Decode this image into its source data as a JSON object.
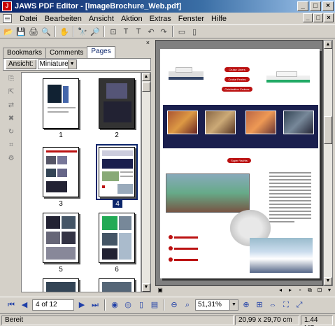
{
  "window": {
    "title": "JAWS PDF Editor - [ImageBrochure_Web.pdf]",
    "app_icon": "J",
    "minimize": "_",
    "maximize": "□",
    "close": "×"
  },
  "menu": {
    "items": [
      "Datei",
      "Bearbeiten",
      "Ansicht",
      "Aktion",
      "Extras",
      "Fenster",
      "Hilfe"
    ],
    "doc_controls": [
      "_",
      "□",
      "×"
    ]
  },
  "toolbar": {
    "icons": [
      "folder-open-icon",
      "save-icon",
      "print-icon",
      "search-doc-icon",
      "hand-icon",
      "binoculars-icon",
      "find-icon",
      "crop-icon",
      "text-tool-icon",
      "text-box-icon",
      "undo-icon",
      "redo-icon",
      "single-page-icon",
      "two-page-icon"
    ],
    "glyphs": [
      "📂",
      "💾",
      "🖨",
      "🔍",
      "✋",
      "🔭",
      "🔎",
      "⊡",
      "T",
      "T",
      "↶",
      "↷",
      "▭",
      "▯"
    ]
  },
  "left_panel": {
    "close_glyph": "×",
    "tabs": [
      "Bookmarks",
      "Comments",
      "Pages"
    ],
    "active_tab": "Pages",
    "view_button": "Ansicht:",
    "view_select": "Miniaturen",
    "pages": [
      {
        "label": "1",
        "selected": false
      },
      {
        "label": "2",
        "selected": false
      },
      {
        "label": "3",
        "selected": false
      },
      {
        "label": "4",
        "selected": true
      },
      {
        "label": "5",
        "selected": false
      },
      {
        "label": "6",
        "selected": false
      }
    ]
  },
  "document": {
    "pills": [
      "Cruise Liners",
      "Cruise Ferries",
      "Celebration Cruises",
      "Super Yachts"
    ],
    "bullets": [
      "",
      "",
      ""
    ]
  },
  "navigation": {
    "page_field": "4 of 12",
    "zoom_field": "51,31%"
  },
  "status": {
    "state": "Bereit",
    "page_size": "20,99 x 29,70 cm",
    "file_size": "1.44 MB"
  },
  "colors": {
    "titlebar": "#0a246a",
    "accent_red": "#b11111",
    "band_navy": "#1a1f4e"
  }
}
